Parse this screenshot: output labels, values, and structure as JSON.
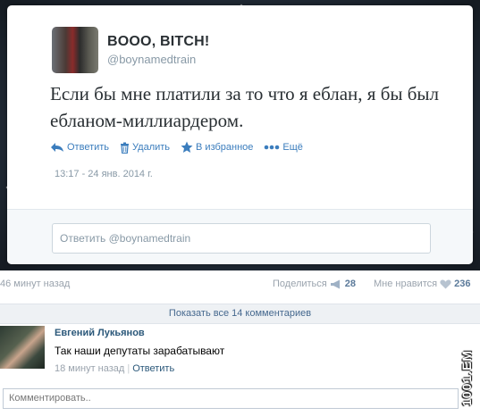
{
  "tweet": {
    "display_name": "BOOO, BITCH!",
    "handle": "@boynamedtrain",
    "text": "Если бы мне платили за то что я еблан, я бы был ебланом-миллиардером.",
    "actions": {
      "reply": "Ответить",
      "delete": "Удалить",
      "favorite": "В избранное",
      "more": "Ещё"
    },
    "timestamp": "13:17 - 24 янв. 2014 г.",
    "reply_placeholder": "Ответить @boynamedtrain"
  },
  "post_meta": {
    "time_ago": "46 минут назад",
    "share_label": "Поделиться",
    "share_count": "28",
    "like_label": "Мне нравится",
    "like_count": "236"
  },
  "show_all_comments": "Показать все 14 комментариев",
  "comment": {
    "author": "Евгений Лукьянов",
    "text": "Так наши депутаты зарабатывают",
    "time": "18 минут назад",
    "reply": "Ответить"
  },
  "comment_placeholder": "Комментировать..",
  "watermark": "1001.EM",
  "colors": {
    "link_blue": "#3b7dbd",
    "vk_blue": "#2b587a",
    "muted": "#8899a6"
  }
}
